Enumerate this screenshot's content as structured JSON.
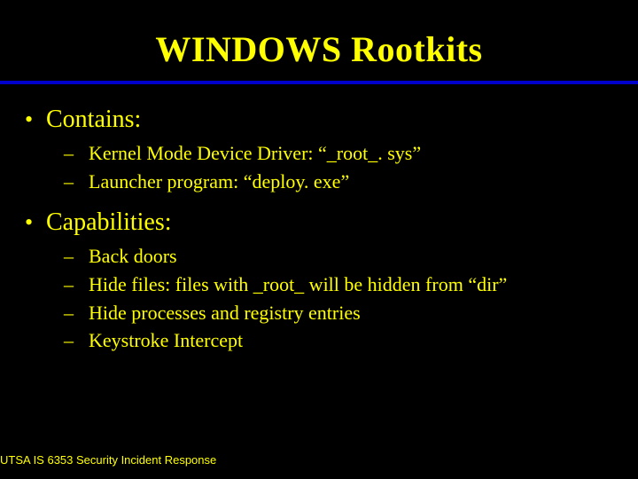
{
  "slide": {
    "title": "WINDOWS Rootkits",
    "bullets": [
      {
        "label": "Contains:",
        "sub": [
          " Kernel Mode Device Driver:   “_root_. sys”",
          "Launcher program: “deploy. exe”"
        ]
      },
      {
        "label": "Capabilities:",
        "sub": [
          " Back doors",
          " Hide files: files with _root_ will be hidden from “dir”",
          " Hide processes and registry entries",
          " Keystroke Intercept"
        ]
      }
    ],
    "footer": "UTSA IS 6353 Security Incident Response"
  }
}
